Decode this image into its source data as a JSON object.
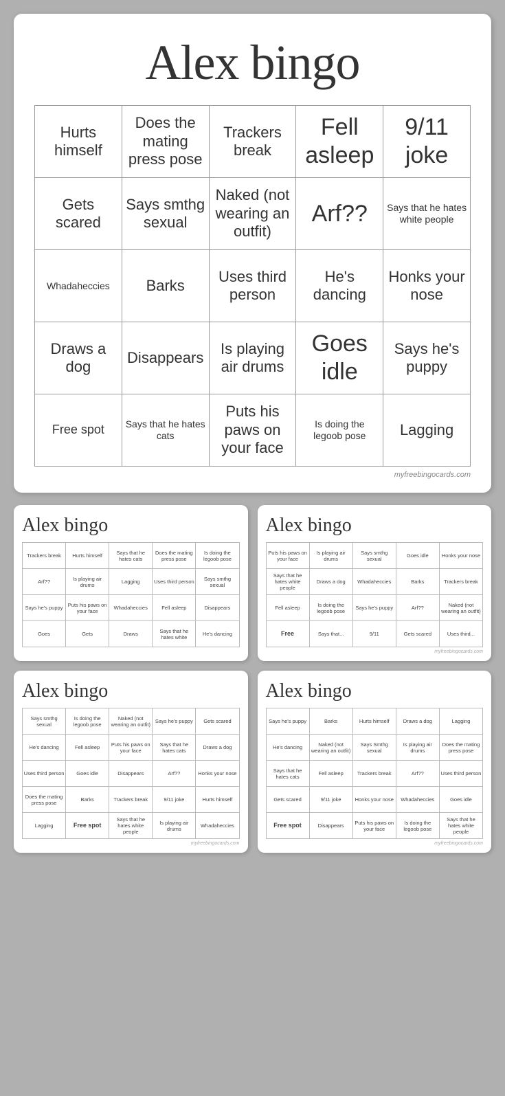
{
  "mainCard": {
    "title": "Alex bingo",
    "rows": [
      [
        "Hurts himself",
        "Does the mating press pose",
        "Trackers break",
        "Fell asleep",
        "9/11 joke"
      ],
      [
        "Gets scared",
        "Says smthg sexual",
        "Naked (not wearing an outfit)",
        "Arf??",
        "Says that he hates white people"
      ],
      [
        "Whadaheccies",
        "Barks",
        "Uses third person",
        "He's dancing",
        "Honks your nose"
      ],
      [
        "Draws a dog",
        "Disappears",
        "Is playing air drums",
        "Goes idle",
        "Says he's puppy"
      ],
      [
        "Free spot",
        "Says that he hates cats",
        "Puts his paws on your face",
        "Is doing the legoob pose",
        "Lagging"
      ]
    ],
    "watermark": "myfreebingocards.com"
  },
  "miniCards": [
    {
      "title": "Alex bingo",
      "rows": [
        [
          "Trackers break",
          "Hurts himself",
          "Says that he hates cats",
          "Does the mating press pose",
          "Is doing the legoob pose"
        ],
        [
          "Arf??",
          "Is playing air drums",
          "Lagging",
          "Uses third person",
          "Says smthg sexual"
        ],
        [
          "Says he's puppy",
          "Puts his paws on your face",
          "Whadaheccies",
          "Fell asleep",
          "Disappears"
        ],
        [
          "Goes",
          "Gets",
          "Draws",
          "Says that he hates white",
          "He's dancing"
        ]
      ]
    },
    {
      "title": "Alex bingo",
      "rows": [
        [
          "Puts his paws on your face",
          "Is playing air drums",
          "Says smthg sexual",
          "Goes idle",
          "Honks your nose"
        ],
        [
          "Says that he hates white people",
          "Draws a dog",
          "Whadaheccies",
          "Barks",
          "Trackers break"
        ],
        [
          "Fell asleep",
          "Is doing the legoob pose",
          "Says he's puppy",
          "Arf??",
          "Naked (not wearing an outfit)"
        ],
        [
          "Free",
          "Says that...",
          "9/11",
          "Gets scared",
          "Uses third..."
        ]
      ],
      "watermark": "myfreebingocards.com"
    },
    {
      "title": "Alex bingo",
      "rows": [
        [
          "Says smthg sexual",
          "Is doing the legoob pose",
          "Naked (not wearing an outfit)",
          "Says he's puppy",
          "Gets scared"
        ],
        [
          "He's dancing",
          "Fell asleep",
          "Puts his paws on your face",
          "Says that he hates cats",
          "Draws a dog"
        ],
        [
          "Uses third person",
          "Goes idle",
          "Disappears",
          "Arf??",
          "Honks your nose"
        ],
        [
          "Does the mating press pose",
          "Barks",
          "Trackers break",
          "9/11 joke",
          "Hurts himself"
        ],
        [
          "Lagging",
          "Free spot",
          "Says that he hates white people",
          "Is playing air drums",
          "Whadaheccies"
        ]
      ],
      "watermark": "myfreebingocards.com"
    },
    {
      "title": "Alex bingo",
      "rows": [
        [
          "Says he's puppy",
          "Barks",
          "Hurts himself",
          "Draws a dog",
          "Lagging"
        ],
        [
          "He's dancing",
          "Naked (not wearing an outfit)",
          "Says Smthg sexual",
          "Is playing air drums",
          "Does the mating press pose"
        ],
        [
          "Says that he hates cats",
          "Fell asleep",
          "Trackers break",
          "Arf??",
          "Uses third person"
        ],
        [
          "Gets scared",
          "9/11 joke",
          "Honks your nose",
          "Whadaheccies",
          "Goes idle"
        ],
        [
          "Free spot",
          "Disappears",
          "Puts his paws on your face",
          "Is doing the legoob pose",
          "Says that he hates white people"
        ]
      ],
      "watermark": "myfreebingocards.com"
    }
  ]
}
